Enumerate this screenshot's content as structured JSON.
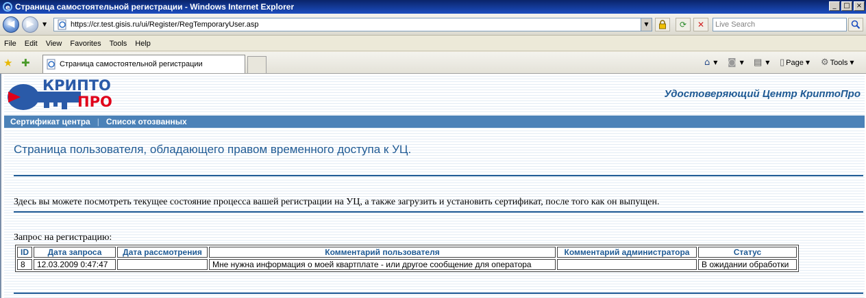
{
  "window": {
    "title": "Страница самостоятельной регистрации - Windows Internet Explorer",
    "minimize": "_",
    "maximize": "□",
    "close": "×"
  },
  "address": {
    "url": "https://cr.test.gisis.ru/ui/Register/RegTemporaryUser.asp",
    "search_placeholder": "Live Search"
  },
  "menu": [
    "File",
    "Edit",
    "View",
    "Favorites",
    "Tools",
    "Help"
  ],
  "tab": {
    "label": "Страница самостоятельной регистрации"
  },
  "commandbar": {
    "page_label": "Page",
    "tools_label": "Tools"
  },
  "icons": {
    "back": "back-arrow-icon",
    "forward": "forward-arrow-icon",
    "lock": "lock-icon",
    "refresh": "refresh-icon",
    "stop": "stop-icon",
    "search": "search-icon",
    "favorites": "favorites-star-icon",
    "add_favorite": "add-favorite-icon",
    "home": "home-icon",
    "feeds": "feeds-icon",
    "print": "print-icon"
  },
  "site": {
    "logo_top": "КРИПТО",
    "logo_bottom": "ПРО",
    "center_title": "Удостоверяющий Центр КриптоПро",
    "nav": [
      "Сертификат центра",
      "Список отозванных"
    ],
    "heading": "Страница пользователя, обладающего правом временного доступа к УЦ.",
    "description": "Здесь вы можете посмотреть текущее состояние процесса вашей регистрации на УЦ, а также загрузить и установить сертификат, после того как он выпущен.",
    "table_caption": "Запрос на регистрацию:"
  },
  "request_table": {
    "headers": [
      "ID",
      "Дата запроса",
      "Дата рассмотрения",
      "Комментарий пользователя",
      "Комментарий администратора",
      "Статус"
    ],
    "rows": [
      [
        "8",
        "12.03.2009 0:47:47",
        "",
        "Мне нужна информация о моей квартплате - или другое сообщение для оператора",
        "",
        "В ожидании обработки"
      ]
    ]
  },
  "colors": {
    "brand_blue": "#1f5a94",
    "nav_strip": "#4c82b8",
    "logo_red": "#e0001a"
  }
}
